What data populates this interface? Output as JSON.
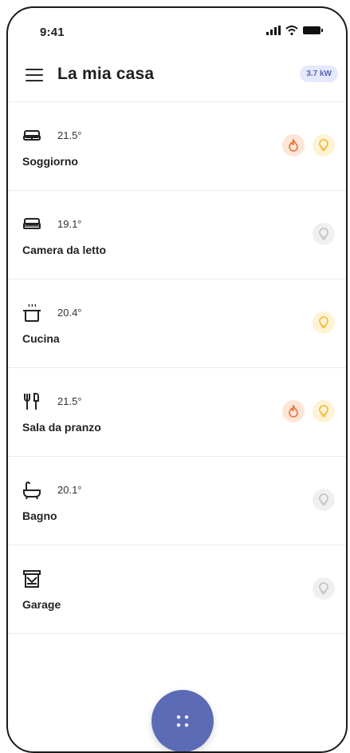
{
  "status_bar": {
    "time": "9:41",
    "icons": [
      "signal-icon",
      "wifi-icon",
      "battery-icon"
    ]
  },
  "header": {
    "title": "La mia casa",
    "power_badge": "3.7 kW"
  },
  "rooms": [
    {
      "name": "Soggiorno",
      "temperature": "21.5°",
      "icon": "sofa-icon",
      "heating": true,
      "light": "on"
    },
    {
      "name": "Camera da letto",
      "temperature": "19.1°",
      "icon": "bed-icon",
      "heating": false,
      "light": "off"
    },
    {
      "name": "Cucina",
      "temperature": "20.4°",
      "icon": "pot-icon",
      "heating": false,
      "light": "on"
    },
    {
      "name": "Sala da pranzo",
      "temperature": "21.5°",
      "icon": "cutlery-icon",
      "heating": true,
      "light": "on"
    },
    {
      "name": "Bagno",
      "temperature": "20.1°",
      "icon": "bathtub-icon",
      "heating": false,
      "light": "off"
    },
    {
      "name": "Garage",
      "temperature": "",
      "icon": "garage-icon",
      "heating": false,
      "light": "off"
    }
  ],
  "colors": {
    "accent": "#5c6bb5",
    "flame": "#e8743a",
    "bulb_on": "#f1b52b",
    "bulb_off": "#bdbdbd"
  },
  "fab": {
    "icon": "grid-dots-icon"
  }
}
